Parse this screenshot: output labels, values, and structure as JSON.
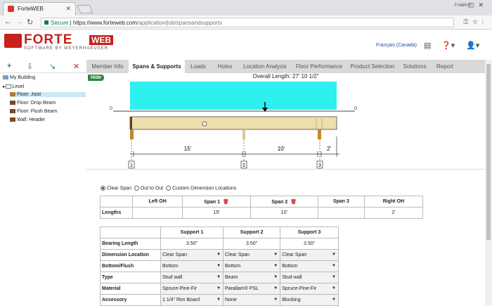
{
  "browser": {
    "tab_title": "ForteWEB",
    "tab_close": "✕",
    "profile_name": "Frédéric",
    "url_secure_label": "Secure",
    "url_host": "https://www.forteweb.com",
    "url_path": "/application/job/spansandsupports"
  },
  "header": {
    "logo_forte": "FORTE",
    "logo_web": "WEB",
    "logo_sub": "SOFTWARE BY WEYERHAEUSER",
    "language": "Français (Canada)"
  },
  "toolbar": {
    "add": "+",
    "delete": "✕"
  },
  "tree": [
    {
      "label": "My Building"
    },
    {
      "label": "Level"
    },
    {
      "label": "Floor: Joist"
    },
    {
      "label": "Floor: Drop Beam"
    },
    {
      "label": "Floor: Flush Beam"
    },
    {
      "label": "Wall: Header"
    }
  ],
  "tabs": [
    {
      "label": "Member Info"
    },
    {
      "label": "Spans & Supports"
    },
    {
      "label": "Loads"
    },
    {
      "label": "Holes"
    },
    {
      "label": "Location Analysis"
    },
    {
      "label": "Floor Performance"
    },
    {
      "label": "Product Selection"
    },
    {
      "label": "Solutions"
    },
    {
      "label": "Report"
    }
  ],
  "diagram": {
    "hide_label": "Hide",
    "overall_length": "Overall Length: 27' 10 1/2\"",
    "left_marker": "0",
    "right_marker": "0",
    "span_labels": [
      "15'",
      "10'",
      "2'"
    ],
    "support_numbers": [
      "1",
      "2",
      "3"
    ]
  },
  "dimension_options": {
    "clear_span": "Clear Span",
    "out_to_out": "Out to Out",
    "custom": "Custom Dimension Locations"
  },
  "lengths_table": {
    "headers": [
      "",
      "Left OH",
      "Span 1",
      "Span 2",
      "Span 3",
      "Right OH"
    ],
    "row_label": "Lengths",
    "values": [
      "",
      "15'",
      "10'",
      "",
      "2'"
    ]
  },
  "supports_table": {
    "headers": [
      "",
      "Support 1",
      "Support 2",
      "Support 3"
    ],
    "rows": [
      {
        "label": "Bearing Length",
        "values": [
          "3.50\"",
          "3.50\"",
          "3.50\""
        ]
      },
      {
        "label": "Dimension Location",
        "values": [
          "Clear Span",
          "Clear Span",
          "Clear Span"
        ]
      },
      {
        "label": "Bottom/Flush",
        "values": [
          "Bottom",
          "Bottom",
          "Bottom"
        ]
      },
      {
        "label": "Type",
        "values": [
          "Stud wall",
          "Beam",
          "Stud wall"
        ]
      },
      {
        "label": "Material",
        "values": [
          "Spruce-Pine-Fir",
          "Parallam® PSL",
          "Spruce-Pine-Fir"
        ]
      },
      {
        "label": "Accessory",
        "values": [
          "1 1/4\" Rim Board",
          "None",
          "Blocking"
        ]
      }
    ]
  }
}
